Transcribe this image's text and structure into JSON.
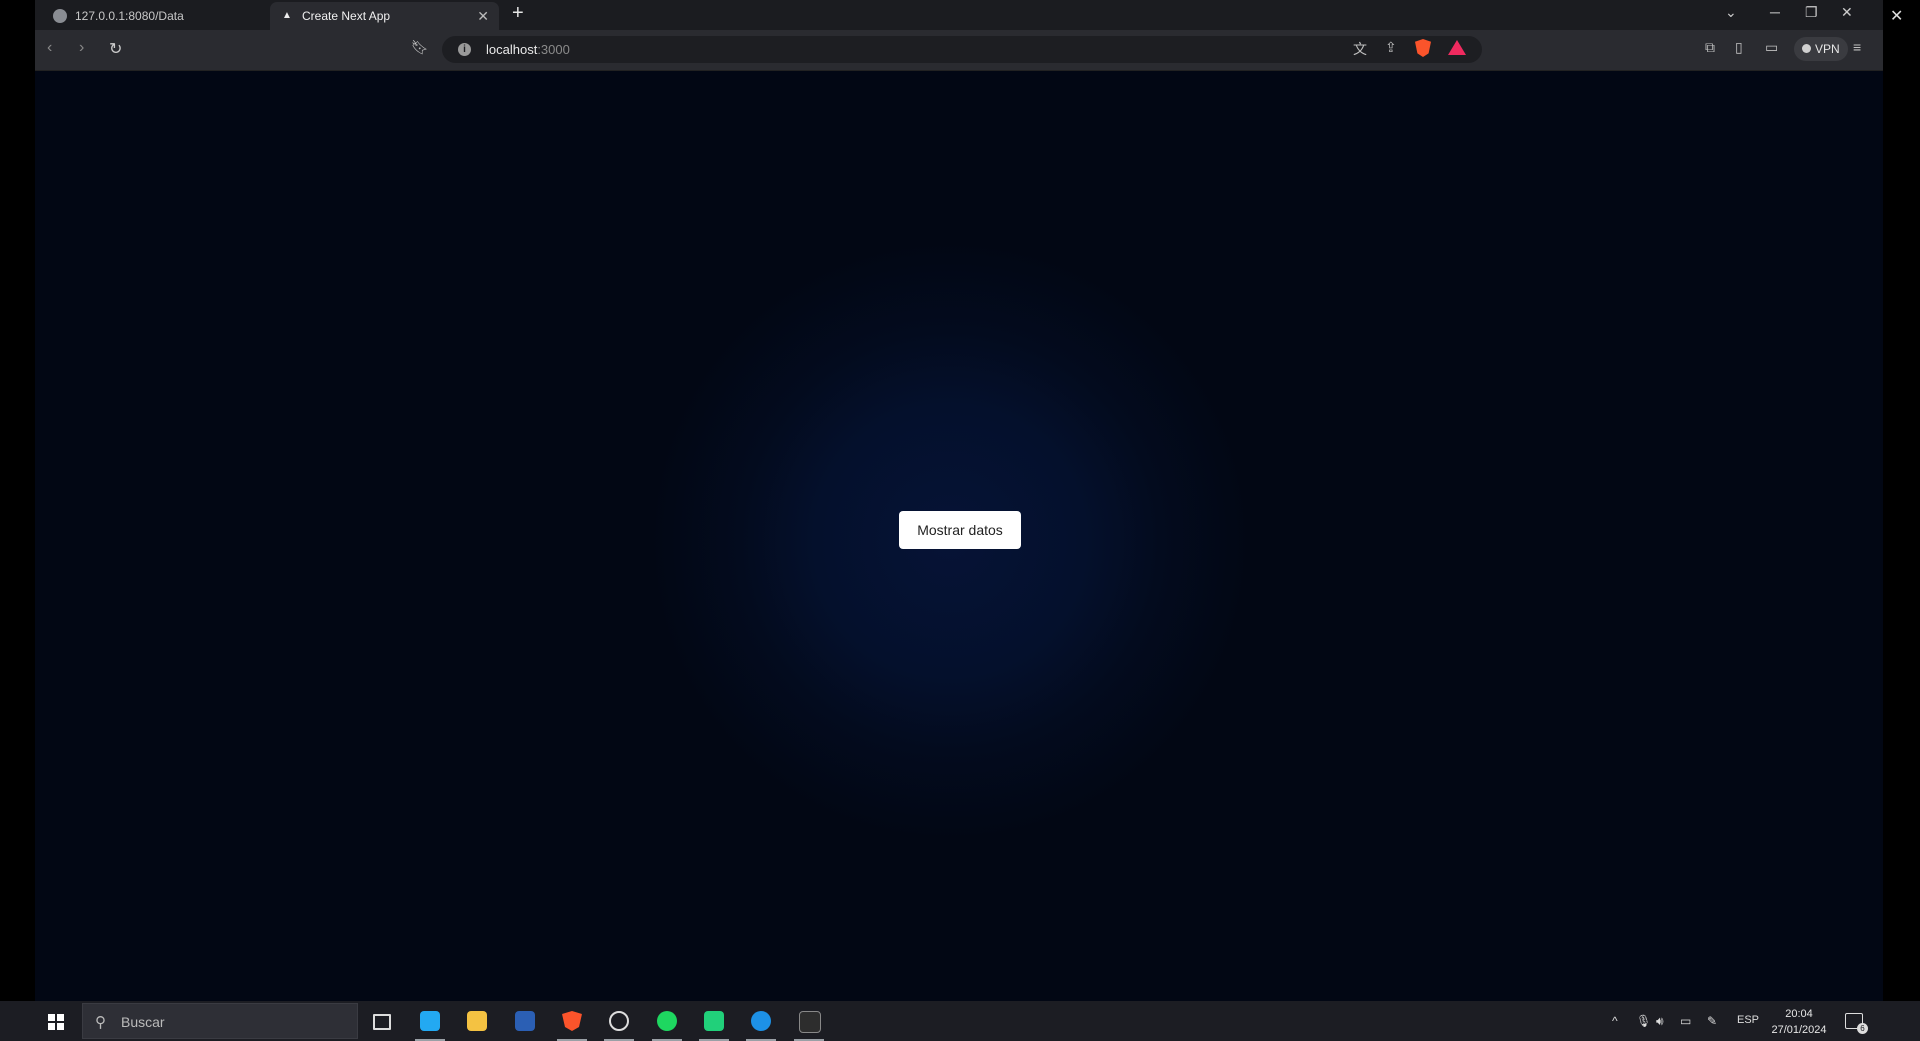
{
  "browser": {
    "tabs": [
      {
        "title": "127.0.0.1:8080/Data"
      },
      {
        "title": "Create Next App"
      }
    ],
    "url": {
      "host": "localhost",
      "port": ":3000"
    },
    "vpn_label": "VPN"
  },
  "page": {
    "button_label": "Mostrar datos",
    "colors": {
      "background": "#030b1e",
      "glow": "#061336",
      "button": "#ffffff"
    }
  },
  "taskbar": {
    "search_placeholder": "Buscar",
    "language": "ESP",
    "time": "20:04",
    "date": "27/01/2024",
    "notification_count": "6",
    "apps": [
      "task-view",
      "vscode",
      "file-explorer",
      "word",
      "brave",
      "app-circle",
      "spotify",
      "green-app",
      "docker",
      "terminal"
    ]
  }
}
